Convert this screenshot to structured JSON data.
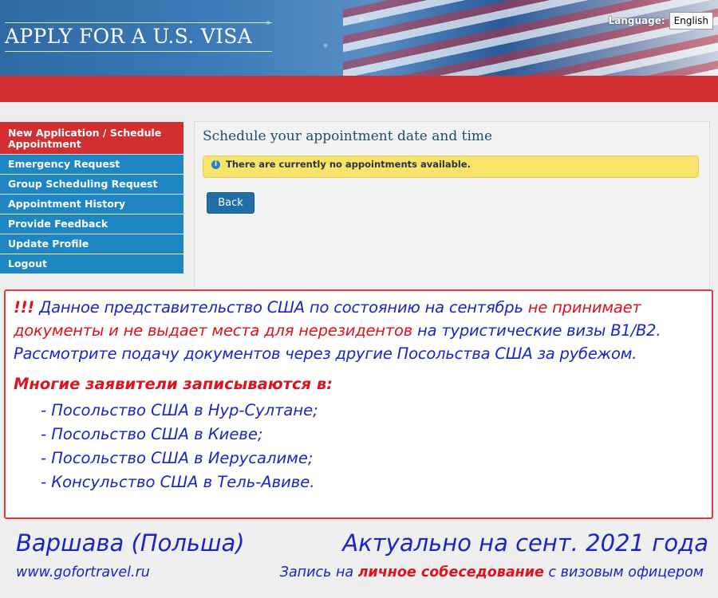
{
  "header": {
    "brand": "APPLY FOR A U.S. VISA",
    "language_label": "Language:",
    "language_value": "English"
  },
  "sidebar": {
    "items": [
      {
        "label": "New Application / Schedule Appointment",
        "active": true
      },
      {
        "label": "Emergency Request"
      },
      {
        "label": "Group Scheduling Request"
      },
      {
        "label": "Appointment History"
      },
      {
        "label": "Provide Feedback"
      },
      {
        "label": "Update Profile"
      },
      {
        "label": "Logout"
      }
    ]
  },
  "main": {
    "title": "Schedule your appointment date and time",
    "alert": "There are currently no appointments available.",
    "back_label": "Back"
  },
  "notice": {
    "marks": "!!!",
    "line1_a": "Данное представительство США по состоянию на сентябрь",
    "line1_red": "не принимает документы и не выдает места для нерезидентов",
    "line1_b": "на туристические визы B1/B2. Рассмотрите подачу документов через другие Посольства США за рубежом.",
    "many_heading": "Многие заявители записываются в:",
    "list": [
      "- Посольство США в Нур-Султане;",
      "- Посольство США в Киеве;",
      "- Посольство США в Иерусалиме;",
      "- Консульство США в Тель-Авиве."
    ]
  },
  "footer": {
    "city": "Варшава (Польша)",
    "actual": "Актуально на сент. 2021 года",
    "url": "www.gofortravel.ru",
    "line_a": "Запись на",
    "line_red": "личное собеседование",
    "line_b": "с визовым офицером"
  },
  "colors": {
    "brand_red": "#d32f30",
    "nav_blue": "#1f86c4",
    "alert_yellow": "#f8e46a",
    "notice_blue": "#1a24c8",
    "notice_red": "#e0121e"
  }
}
